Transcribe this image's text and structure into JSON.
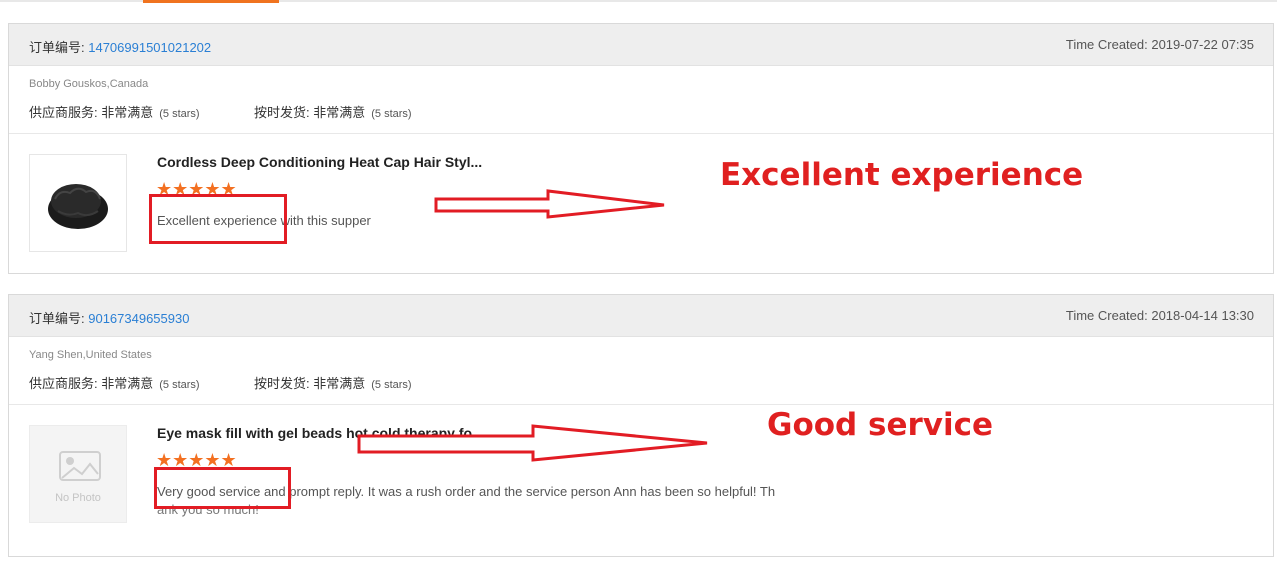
{
  "orders": [
    {
      "order_label": "订单编号: ",
      "order_number": "14706991501021202",
      "time_created": "Time Created: 2019-07-22 07:35",
      "buyer": "Bobby Gouskos,Canada",
      "ratings": [
        {
          "label": "供应商服务: 非常满意",
          "stars_note": "(5 stars)"
        },
        {
          "label": "按时发货: 非常满意",
          "stars_note": "(5 stars)"
        }
      ],
      "product_title": "Cordless Deep Conditioning Heat Cap Hair Styl...",
      "star_rating": "★★★★★",
      "stars_value": 5,
      "review": "Excellent experience with this supper"
    },
    {
      "order_label": "订单编号: ",
      "order_number": "90167349655930",
      "time_created": "Time Created: 2018-04-14 13:30",
      "buyer": "Yang Shen,United States",
      "ratings": [
        {
          "label": "供应商服务: 非常满意",
          "stars_note": "(5 stars)"
        },
        {
          "label": "按时发货: 非常满意",
          "stars_note": "(5 stars)"
        }
      ],
      "product_title": "Eye mask fill with gel beads hot cold therapy fo...",
      "star_rating": "★★★★★",
      "stars_value": 5,
      "no_photo": "No Photo",
      "review_line1": "Very good service and prompt reply. It was a rush order and the service person Ann has been so helpful! Th",
      "review_line2": "ank you so much!"
    }
  ],
  "annotations": {
    "label1": "Excellent experience",
    "label2": "Good service"
  },
  "colors": {
    "accent_orange": "#f37021",
    "link_blue": "#2a7fd4",
    "annotation_red": "#e21c24"
  }
}
